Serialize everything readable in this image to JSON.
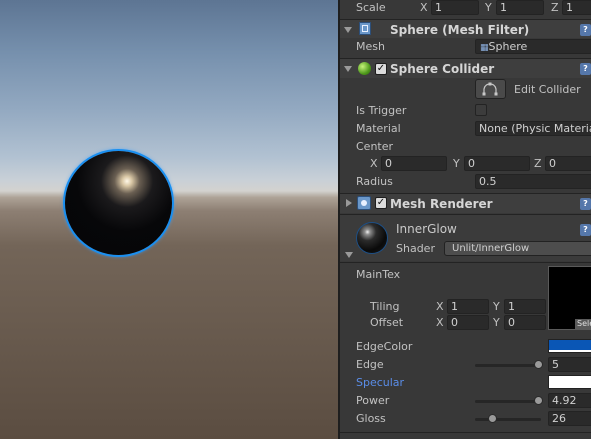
{
  "transform": {
    "scale_label": "Scale",
    "x_label": "X",
    "x_value": "1",
    "y_label": "Y",
    "y_value": "1",
    "z_label": "Z",
    "z_value": "1"
  },
  "mesh_filter": {
    "title": "Sphere (Mesh Filter)",
    "mesh_label": "Mesh",
    "mesh_value": "Sphere"
  },
  "sphere_collider": {
    "title": "Sphere Collider",
    "enabled": true,
    "edit_label": "Edit Collider",
    "is_trigger_label": "Is Trigger",
    "is_trigger": false,
    "material_label": "Material",
    "material_value": "None (Physic Material)",
    "center_label": "Center",
    "cx_label": "X",
    "cx_value": "0",
    "cy_label": "Y",
    "cy_value": "0",
    "cz_label": "Z",
    "cz_value": "0",
    "radius_label": "Radius",
    "radius_value": "0.5"
  },
  "mesh_renderer": {
    "title": "Mesh Renderer",
    "enabled": true
  },
  "material": {
    "name": "InnerGlow",
    "shader_label": "Shader",
    "shader_value": "Unlit/InnerGlow",
    "maintex_label": "MainTex",
    "tiling_label": "Tiling",
    "tiling_x_label": "X",
    "tiling_x": "1",
    "tiling_y_label": "Y",
    "tiling_y": "1",
    "offset_label": "Offset",
    "offset_x_label": "X",
    "offset_x": "0",
    "offset_y_label": "Y",
    "offset_y": "0",
    "select_label": "Select",
    "edgecolor_label": "EdgeColor",
    "edgecolor_value": "#0a56b5",
    "edge_label": "Edge",
    "edge_value": "5",
    "edge_fraction": 0.97,
    "specular_label": "Specular",
    "specular_value": "#ffffff",
    "power_label": "Power",
    "power_value": "4.92",
    "power_fraction": 0.97,
    "gloss_label": "Gloss",
    "gloss_value": "26",
    "gloss_fraction": 0.27
  },
  "colors": {
    "accent_label": "#5a8de8",
    "edge_outline": "#1a8ff0"
  }
}
